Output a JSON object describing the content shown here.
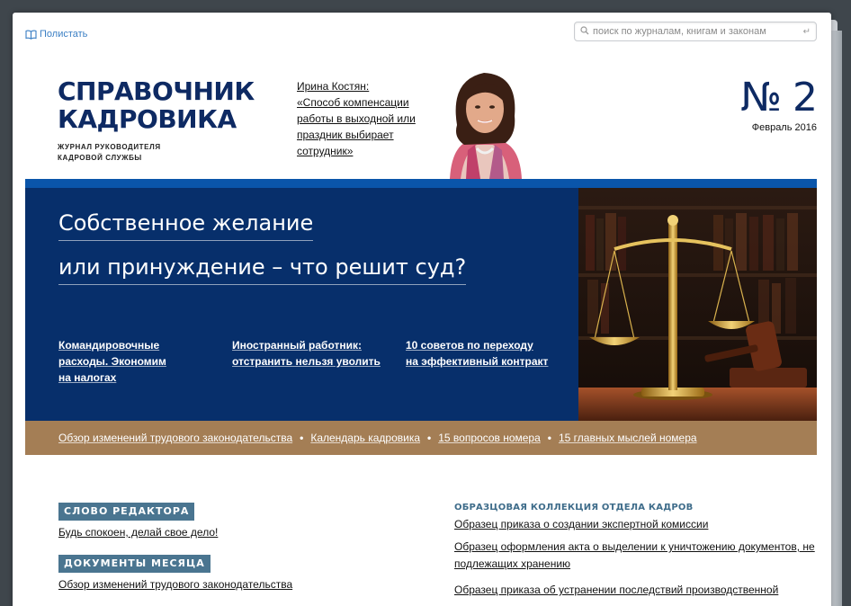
{
  "toolbar": {
    "flip_label": "Полистать",
    "search_placeholder": "поиск по журналам, книгам и законам"
  },
  "masthead": {
    "title_line1": "СПРАВОЧНИК",
    "title_line2": "КАДРОВИКА",
    "subtitle_line1": "ЖУРНАЛ РУКОВОДИТЕЛЯ",
    "subtitle_line2": "КАДРОВОЙ СЛУЖБЫ",
    "issue_number": "№ 2",
    "issue_date": "Февраль 2016"
  },
  "teaser": {
    "author": "Ирина Костян:",
    "text": "«Способ компенсации работы в выходной или праздник выбирает сотрудник»"
  },
  "banner": {
    "headline_line1": "Собственное желание",
    "headline_line2": "или принуждение – что решит суд?",
    "subs": [
      {
        "line1": "Командировочные",
        "line2": "расходы. Экономим",
        "line3": "на налогах"
      },
      {
        "line1": "Иностранный работник:",
        "line2": "отстранить нельзя уволить"
      },
      {
        "line1": "10 советов по переходу",
        "line2": "на эффективный контракт"
      }
    ]
  },
  "tan_bar": {
    "links": [
      "Обзор изменений трудового законодательства",
      "Календарь кадровика",
      "15 вопросов номера",
      "15 главных мыслей номера"
    ],
    "separator": "•"
  },
  "left": {
    "section1_label": "СЛОВО РЕДАКТОРА",
    "section1_link": "Будь спокоен, делай свое дело!",
    "section2_label": "ДОКУМЕНТЫ МЕСЯЦА",
    "section2_link": "Обзор изменений трудового законодательства"
  },
  "right": {
    "heading": "ОБРАЗЦОВАЯ КОЛЛЕКЦИЯ ОТДЕЛА КАДРОВ",
    "links": [
      "Образец приказа о создании экспертной комиссии",
      "Образец оформления акта о выделении к уничтожению документов, не подлежащих хранению",
      "Образец приказа об устранении последствий производственной"
    ]
  },
  "colors": {
    "brand_navy": "#0e2a63",
    "banner_blue": "#072f6b",
    "accent_bar": "#0a55aa",
    "tan_bar": "#a47e55",
    "section_label": "#4a7590"
  }
}
